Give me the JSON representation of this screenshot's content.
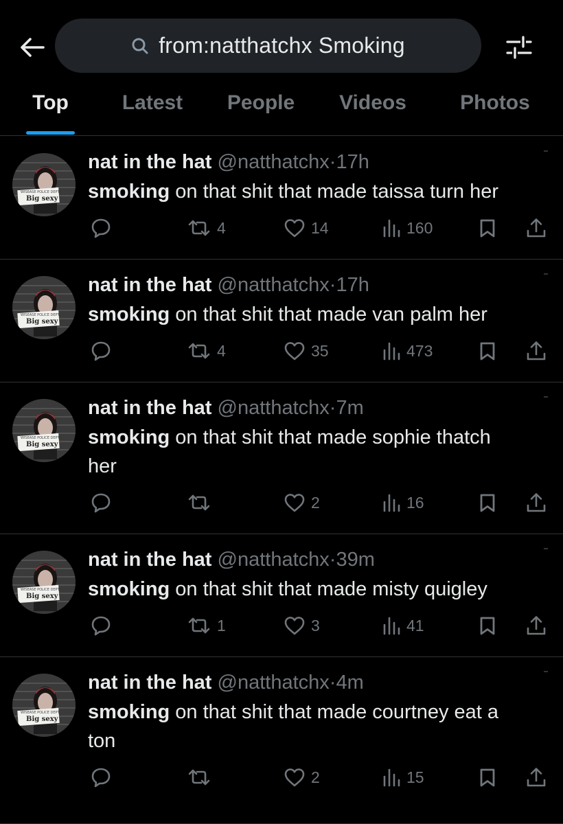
{
  "search": {
    "query": "from:natthatchx Smoking"
  },
  "icons": {
    "back": "arrow-left-icon",
    "search": "search-icon",
    "filter": "sliders-icon",
    "reply": "reply-icon",
    "retweet": "retweet-icon",
    "like": "heart-icon",
    "views": "views-bar-chart-icon",
    "bookmark": "bookmark-icon",
    "share": "share-icon"
  },
  "tabs": [
    {
      "label": "Top",
      "active": true
    },
    {
      "label": "Latest",
      "active": false
    },
    {
      "label": "People",
      "active": false
    },
    {
      "label": "Videos",
      "active": false
    },
    {
      "label": "Photos",
      "active": false
    }
  ],
  "avatar": {
    "sign_top": "WISEASE POLICE DEPT",
    "sign_text": "Big sexy"
  },
  "colors": {
    "background": "#000000",
    "accent": "#1d9bf0",
    "muted": "#71767b",
    "text": "#e7e9ea",
    "search_fill": "#202327"
  },
  "tweets": [
    {
      "name": "nat in the hat",
      "handle": "@natthatchx",
      "sep": "·",
      "time": "17h",
      "bold": "smoking",
      "line1": " on that shit that made taissa turn her",
      "line2": "",
      "retweets": "4",
      "likes": "14",
      "views": "160"
    },
    {
      "name": "nat in the hat",
      "handle": "@natthatchx",
      "sep": "·",
      "time": "17h",
      "bold": "smoking",
      "line1": " on that shit that made van palm her",
      "line2": "",
      "retweets": "4",
      "likes": "35",
      "views": "473"
    },
    {
      "name": "nat in the hat",
      "handle": "@natthatchx",
      "sep": "·",
      "time": "7m",
      "bold": "smoking",
      "line1": " on that shit that made sophie thatch",
      "line2": "her",
      "retweets": "",
      "likes": "2",
      "views": "16"
    },
    {
      "name": "nat in the hat",
      "handle": "@natthatchx",
      "sep": "·",
      "time": "39m",
      "bold": "smoking",
      "line1": " on that shit that made misty quigley",
      "line2": "",
      "retweets": "1",
      "likes": "3",
      "views": "41"
    },
    {
      "name": "nat in the hat",
      "handle": "@natthatchx",
      "sep": "·",
      "time": "4m",
      "bold": "smoking",
      "line1": " on that shit that made courtney eat a",
      "line2": "ton",
      "retweets": "",
      "likes": "2",
      "views": "15"
    }
  ]
}
